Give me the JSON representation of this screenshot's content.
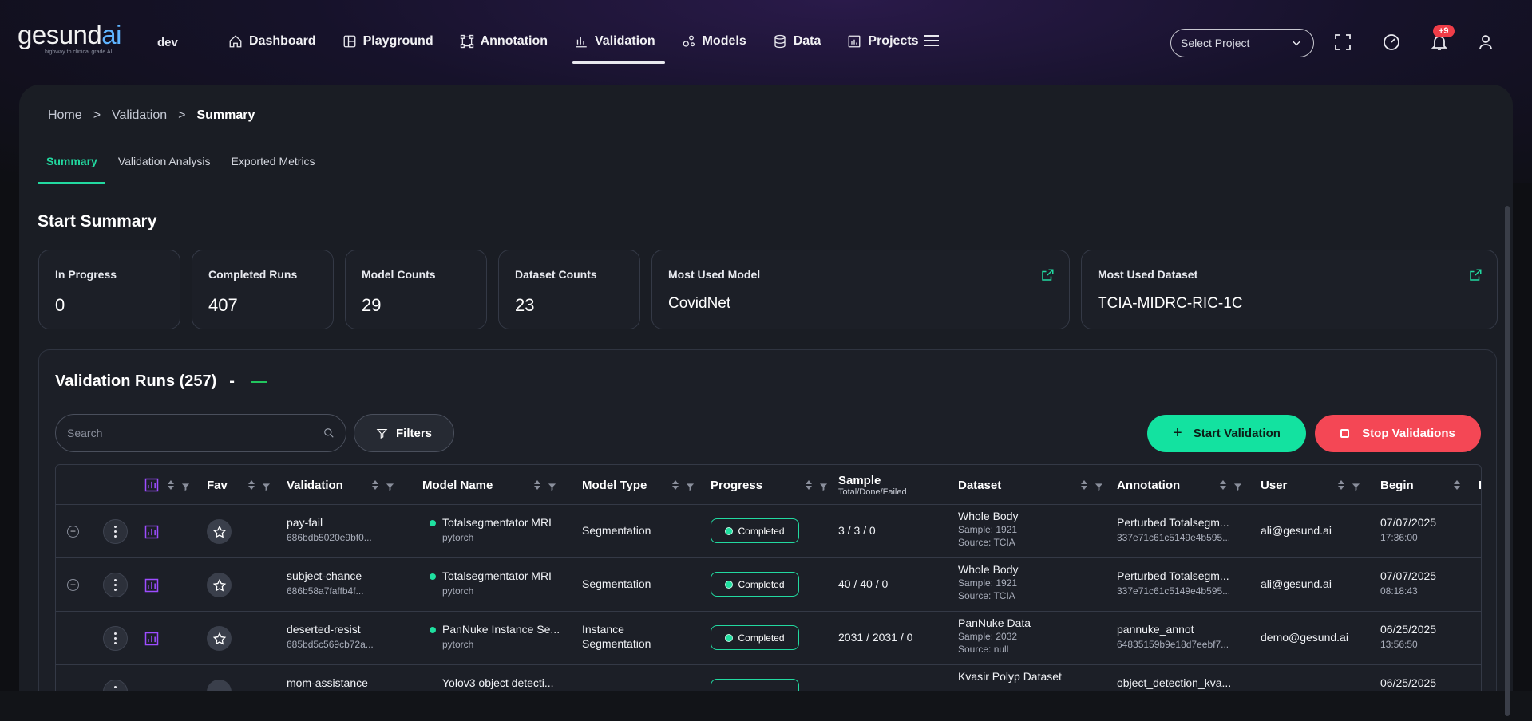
{
  "brand": {
    "logo_main": "gesund",
    "logo_ai": "ai",
    "tagline": "highway to clinical grade AI",
    "env": "dev"
  },
  "nav": [
    {
      "label": "Dashboard",
      "icon": "home-icon"
    },
    {
      "label": "Playground",
      "icon": "layout-icon"
    },
    {
      "label": "Annotation",
      "icon": "annotation-icon"
    },
    {
      "label": "Validation",
      "icon": "bar-chart-icon",
      "active": true
    },
    {
      "label": "Models",
      "icon": "models-icon"
    },
    {
      "label": "Data",
      "icon": "database-icon"
    },
    {
      "label": "Projects",
      "icon": "projects-icon"
    }
  ],
  "topbar": {
    "select_project": "Select Project",
    "notification_count": "+9"
  },
  "breadcrumb": {
    "home": "Home",
    "sep": ">",
    "validation": "Validation",
    "current": "Summary"
  },
  "tabs": [
    "Summary",
    "Validation Analysis",
    "Exported Metrics"
  ],
  "start_summary": {
    "title": "Start Summary"
  },
  "cards": [
    {
      "label": "In Progress",
      "value": "0"
    },
    {
      "label": "Completed Runs",
      "value": "407"
    },
    {
      "label": "Model Counts",
      "value": "29"
    },
    {
      "label": "Dataset Counts",
      "value": "23"
    },
    {
      "label": "Most Used Model",
      "value": "CovidNet"
    },
    {
      "label": "Most Used Dataset",
      "value": "TCIA-MIDRC-RIC-1C"
    }
  ],
  "runs": {
    "title": "Validation Runs (257)",
    "dash": "-",
    "search_placeholder": "Search",
    "filters_label": "Filters",
    "start_label": "Start Validation",
    "stop_label": "Stop Validations"
  },
  "columns": {
    "fav": "Fav",
    "validation": "Validation",
    "model_name": "Model Name",
    "model_type": "Model Type",
    "progress": "Progress",
    "sample": "Sample",
    "sample_sub": "Total/Done/Failed",
    "dataset": "Dataset",
    "annotation": "Annotation",
    "user": "User",
    "begin": "Begin"
  },
  "rows": [
    {
      "name": "pay-fail",
      "id": "686bdb5020e9bf0...",
      "model": "Totalsegmentator MRI",
      "framework": "pytorch",
      "type": "Segmentation",
      "type2": "",
      "status": "Completed",
      "sample": "3 / 3 / 0",
      "dataset": "Whole Body",
      "ds_sample": "Sample: 1921",
      "ds_source": "Source: TCIA",
      "annotation": "Perturbed Totalsegm...",
      "ann_id": "337e71c61c5149e4b595...",
      "user": "ali@gesund.ai",
      "date": "07/07/2025",
      "time": "17:36:00"
    },
    {
      "name": "subject-chance",
      "id": "686b58a7faffb4f...",
      "model": "Totalsegmentator MRI",
      "framework": "pytorch",
      "type": "Segmentation",
      "type2": "",
      "status": "Completed",
      "sample": "40 / 40 / 0",
      "dataset": "Whole Body",
      "ds_sample": "Sample: 1921",
      "ds_source": "Source: TCIA",
      "annotation": "Perturbed Totalsegm...",
      "ann_id": "337e71c61c5149e4b595...",
      "user": "ali@gesund.ai",
      "date": "07/07/2025",
      "time": "08:18:43"
    },
    {
      "name": "deserted-resist",
      "id": "685bd5c569cb72a...",
      "model": "PanNuke Instance Se...",
      "framework": "pytorch",
      "type": "Instance",
      "type2": "Segmentation",
      "status": "Completed",
      "sample": "2031 / 2031 / 0",
      "dataset": "PanNuke Data",
      "ds_sample": "Sample: 2032",
      "ds_source": "Source: null",
      "annotation": "pannuke_annot",
      "ann_id": "64835159b9e18d7eebf7...",
      "user": "demo@gesund.ai",
      "date": "06/25/2025",
      "time": "13:56:50"
    },
    {
      "name": "mom-assistance",
      "id": "",
      "model": "Yolov3 object detecti...",
      "framework": "",
      "type": "",
      "type2": "",
      "status": "",
      "sample": "",
      "dataset": "Kvasir Polyp Dataset",
      "ds_sample": "",
      "ds_source": "",
      "annotation": "object_detection_kva...",
      "ann_id": "",
      "user": "",
      "date": "06/25/2025",
      "time": ""
    }
  ]
}
